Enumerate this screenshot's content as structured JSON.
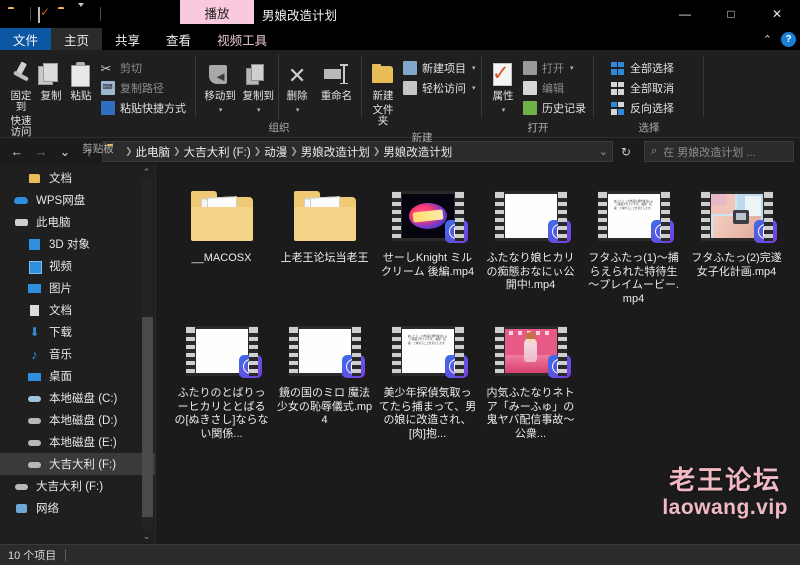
{
  "titlebar": {
    "qat": [
      {
        "name": "folder-icon",
        "label": ""
      },
      {
        "name": "properties-icon",
        "label": ""
      },
      {
        "name": "new-folder-icon",
        "label": ""
      },
      {
        "name": "chevron-down-icon",
        "label": ""
      }
    ],
    "play_tab": "播放",
    "window_title": "男娘改造计划",
    "minimize": "—",
    "maximize": "□",
    "close": "✕"
  },
  "tabs": [
    {
      "label": "文件",
      "state": "file"
    },
    {
      "label": "主页",
      "state": "active"
    },
    {
      "label": "共享",
      "state": "normal"
    },
    {
      "label": "查看",
      "state": "normal"
    },
    {
      "label": "视频工具",
      "state": "contextual"
    }
  ],
  "tab_right": {
    "collapse": "⌃",
    "help": "?"
  },
  "ribbon": {
    "groups": [
      {
        "title": "剪贴板",
        "big": [
          {
            "label1": "固定到",
            "label2": "快速访问",
            "icon": "pin-icon"
          },
          {
            "label1": "复制",
            "label2": "",
            "icon": "copy-icon"
          },
          {
            "label1": "粘贴",
            "label2": "",
            "icon": "paste-icon"
          }
        ],
        "small": [
          {
            "label": "剪切",
            "icon": "scissors-icon",
            "dim": true
          },
          {
            "label": "复制路径",
            "icon": "copy-path-icon",
            "dim": true
          },
          {
            "label": "粘贴快捷方式",
            "icon": "paste-shortcut-icon",
            "dim": false
          }
        ]
      },
      {
        "title": "组织",
        "big": [
          {
            "label1": "移动到",
            "label2": "",
            "icon": "move-to-icon"
          },
          {
            "label1": "复制到",
            "label2": "",
            "icon": "copy-to-icon"
          },
          {
            "label1": "删除",
            "label2": "",
            "icon": "delete-icon"
          },
          {
            "label1": "重命名",
            "label2": "",
            "icon": "rename-icon"
          }
        ],
        "small": []
      },
      {
        "title": "新建",
        "big": [
          {
            "label1": "新建",
            "label2": "文件夹",
            "icon": "new-folder-icon"
          }
        ],
        "small": [
          {
            "label": "新建项目",
            "icon": "new-item-icon",
            "dim": false
          },
          {
            "label": "轻松访问",
            "icon": "easy-access-icon",
            "dim": false
          }
        ]
      },
      {
        "title": "打开",
        "big": [
          {
            "label1": "属性",
            "label2": "",
            "icon": "properties-icon"
          }
        ],
        "small": [
          {
            "label": "打开",
            "icon": "open-icon",
            "dim": true
          },
          {
            "label": "编辑",
            "icon": "edit-icon",
            "dim": true
          },
          {
            "label": "历史记录",
            "icon": "history-icon",
            "dim": false
          }
        ]
      },
      {
        "title": "选择",
        "big": [],
        "small": [
          {
            "label": "全部选择",
            "icon": "select-all-icon",
            "dim": false
          },
          {
            "label": "全部取消",
            "icon": "select-none-icon",
            "dim": false
          },
          {
            "label": "反向选择",
            "icon": "invert-selection-icon",
            "dim": false
          }
        ]
      }
    ]
  },
  "addressbar": {
    "back": "←",
    "forward": "→",
    "recent": "⌄",
    "up": "↑",
    "crumbs": [
      "此电脑",
      "大吉大利 (F:)",
      "动漫",
      "男娘改造计划",
      "男娘改造计划"
    ],
    "dropdown": "⌄",
    "refresh": "↻",
    "search_placeholder": "在 男娘改造计划 ...",
    "search_value": ""
  },
  "nav": {
    "items": [
      {
        "label": "文档",
        "icon": "folder-icon",
        "level": 2,
        "selected": false
      },
      {
        "label": "WPS网盘",
        "icon": "cloud-icon",
        "level": 1,
        "selected": false
      },
      {
        "label": "此电脑",
        "icon": "pc-icon",
        "level": 1,
        "selected": false
      },
      {
        "label": "3D 对象",
        "icon": "3d-objects-icon",
        "level": 2,
        "selected": false
      },
      {
        "label": "视频",
        "icon": "videos-icon",
        "level": 2,
        "selected": false
      },
      {
        "label": "图片",
        "icon": "pictures-icon",
        "level": 2,
        "selected": false
      },
      {
        "label": "文档",
        "icon": "documents-icon",
        "level": 2,
        "selected": false
      },
      {
        "label": "下载",
        "icon": "downloads-icon",
        "level": 2,
        "selected": false
      },
      {
        "label": "音乐",
        "icon": "music-icon",
        "level": 2,
        "selected": false
      },
      {
        "label": "桌面",
        "icon": "desktop-icon",
        "level": 2,
        "selected": false
      },
      {
        "label": "本地磁盘 (C:)",
        "icon": "drive-system-icon",
        "level": 2,
        "selected": false
      },
      {
        "label": "本地磁盘 (D:)",
        "icon": "drive-icon",
        "level": 2,
        "selected": false
      },
      {
        "label": "本地磁盘 (E:)",
        "icon": "drive-icon",
        "level": 2,
        "selected": false
      },
      {
        "label": "大吉大利 (F:)",
        "icon": "drive-icon",
        "level": 2,
        "selected": true
      },
      {
        "label": "大吉大利 (F:)",
        "icon": "drive-icon",
        "level": 1,
        "selected": false
      },
      {
        "label": "网络",
        "icon": "network-icon",
        "level": 1,
        "selected": false
      }
    ],
    "scroll_up": "⌃",
    "scroll_down": "⌄"
  },
  "files": [
    {
      "name": "__MACOSX",
      "type": "folder",
      "art": "folder"
    },
    {
      "name": "上老王论坛当老王",
      "type": "folder",
      "art": "folder"
    },
    {
      "name": "せーしKnight ミルクリーム 後編.mp4",
      "type": "video",
      "art": "seeshi"
    },
    {
      "name": "ふたなり娘ヒカリの痴態おなにぃ公開中!.mp4",
      "type": "video",
      "art": "white"
    },
    {
      "name": "フタふたっ(1)～捕らえられた特待生～プレイムービー.mp4",
      "type": "video",
      "art": "doc"
    },
    {
      "name": "フタふたっ(2)完遂女子化計画.mp4",
      "type": "video",
      "art": "girl"
    },
    {
      "name": "ふたりのとばりっーヒカリととばるの[ぬきさし]ならない関係...",
      "type": "video",
      "art": "white"
    },
    {
      "name": "鏡の国のミロ 魔法少女の恥辱儀式.mp4",
      "type": "video",
      "art": "white"
    },
    {
      "name": "美少年探偵気取ってたら捕まって、男の娘に改造され、[肉]抱...",
      "type": "video",
      "art": "doc"
    },
    {
      "name": "内気ふたなりネトア「みーふゅ」の鬼ヤバ配信事故～公衆...",
      "type": "video",
      "art": "pink"
    }
  ],
  "thumbnail_doc_text": "あにとろ\nこの作品は著作権法により保護されています。\n複製・転載・上映することを禁止します。",
  "status": {
    "items_count": "10 个项目"
  },
  "watermark": {
    "line1": "老王论坛",
    "line2": "laowang.vip"
  },
  "colors": {
    "accent_blue": "#0b57a4",
    "play_tab_pink": "#f9c9dd",
    "folder_yellow": "#e8bd58",
    "window_bg": "#1b1b1b",
    "watermark_pink": "#f1b9c4"
  }
}
